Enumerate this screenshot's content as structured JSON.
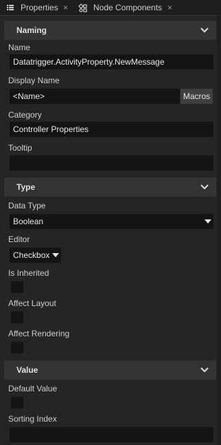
{
  "tabs": [
    {
      "label": "Properties",
      "icon": "list-icon",
      "close": "×"
    },
    {
      "label": "Node Components",
      "icon": "components-icon",
      "close": "×"
    }
  ],
  "sections": {
    "naming": {
      "title": "Naming",
      "name_label": "Name",
      "name_value": "Datatrigger.ActivityProperty.NewMessage",
      "display_name_label": "Display Name",
      "display_name_value": "<Name>",
      "macros_label": "Macros",
      "category_label": "Category",
      "category_value": "Controller Properties",
      "tooltip_label": "Tooltip",
      "tooltip_value": ""
    },
    "type": {
      "title": "Type",
      "data_type_label": "Data Type",
      "data_type_value": "Boolean",
      "editor_label": "Editor",
      "editor_value": "Checkbox",
      "is_inherited_label": "Is Inherited",
      "affect_layout_label": "Affect Layout",
      "affect_rendering_label": "Affect Rendering"
    },
    "value": {
      "title": "Value",
      "default_value_label": "Default Value",
      "sorting_index_label": "Sorting Index",
      "sorting_index_value": ""
    }
  },
  "colors": {
    "background": "#252525",
    "header": "#333333",
    "field": "#141414",
    "text": "#d6d6d6"
  }
}
